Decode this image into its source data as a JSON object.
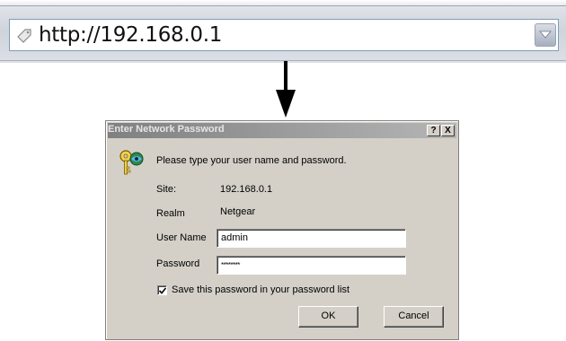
{
  "address_bar": {
    "url": "http://192.168.0.1",
    "page_icon": "page-icon",
    "dropdown_icon": "chevron-down-icon"
  },
  "arrow_icon": "arrow-down-icon",
  "dialog": {
    "title": "Enter Network Password",
    "help_button": "?",
    "close_button": "X",
    "icon": "key-icon",
    "prompt": "Please type your user name and password.",
    "site_label": "Site:",
    "site_value": "192.168.0.1",
    "realm_label": "Realm",
    "realm_value": "Netgear",
    "username_label": "User Name",
    "username_value": "admin",
    "password_label": "Password",
    "password_value": "********",
    "save_label": "Save this password in your password list",
    "save_checked": true,
    "ok_label": "OK",
    "cancel_label": "Cancel"
  },
  "colors": {
    "dialog_face": "#d4d0c8",
    "titlebar_start": "#808080",
    "titlebar_end": "#b5b5b5",
    "address_border": "#7f9db9"
  }
}
